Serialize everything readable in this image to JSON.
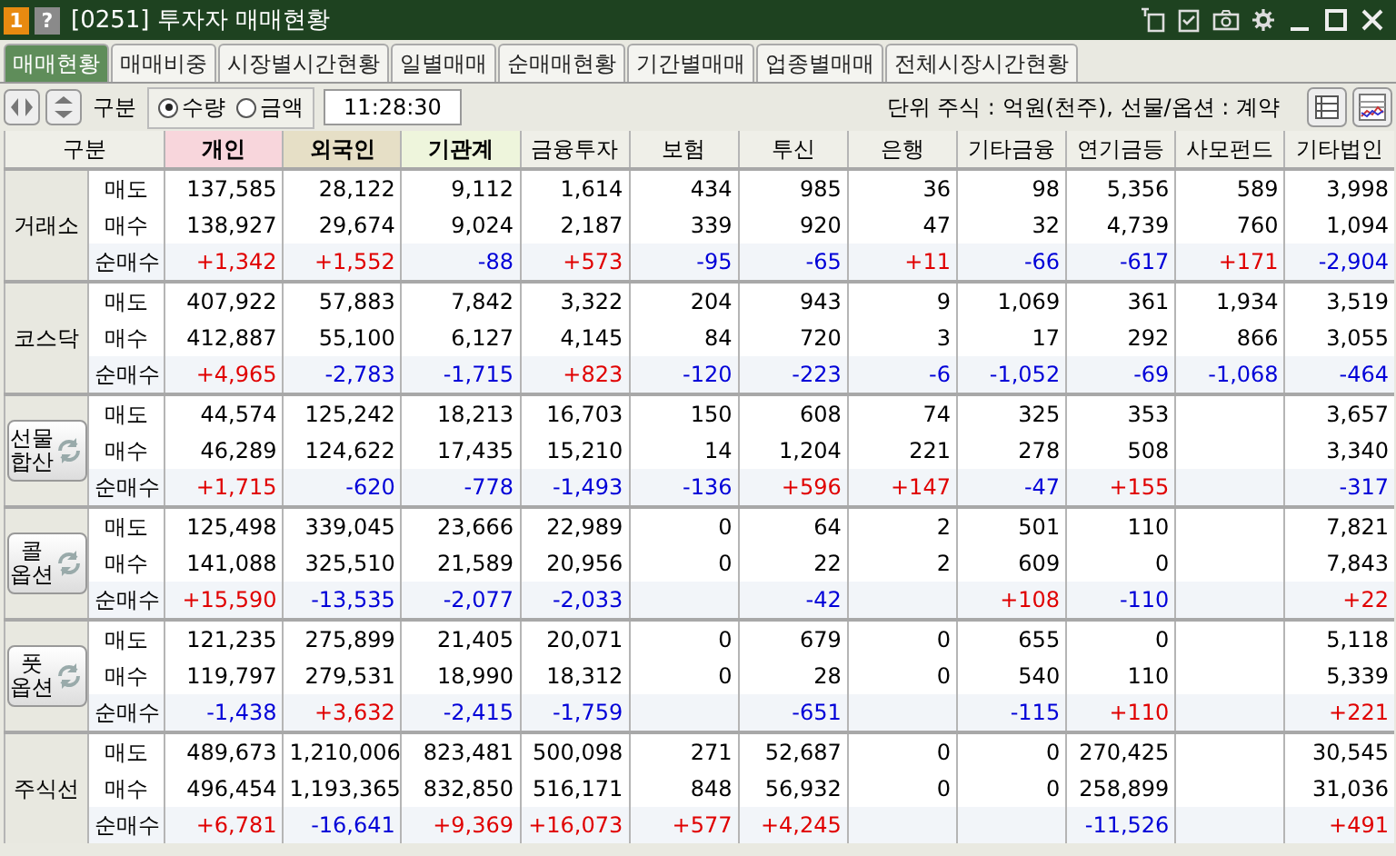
{
  "window": {
    "badge": "1",
    "help": "?",
    "title": "[0251] 투자자 매매현황"
  },
  "tabs": [
    {
      "label": "매매현황",
      "selected": true
    },
    {
      "label": "매매비중",
      "selected": false
    },
    {
      "label": "시장별시간현황",
      "selected": false
    },
    {
      "label": "일별매매",
      "selected": false
    },
    {
      "label": "순매매현황",
      "selected": false
    },
    {
      "label": "기간별매매",
      "selected": false
    },
    {
      "label": "업종별매매",
      "selected": false
    },
    {
      "label": "전체시장시간현황",
      "selected": false
    }
  ],
  "toolbar": {
    "label": "구분",
    "options": [
      {
        "label": "수량",
        "selected": true
      },
      {
        "label": "금액",
        "selected": false
      }
    ],
    "time": "11:28:30",
    "unit": "단위 주식 : 억원(천주), 선물/옵션 : 계약"
  },
  "table": {
    "header": "구분",
    "columns": [
      {
        "label": "개인",
        "color": "#f8d6dc"
      },
      {
        "label": "외국인",
        "color": "#e6dfc6"
      },
      {
        "label": "기관계",
        "color": "#eef5dc"
      },
      {
        "label": "금융투자"
      },
      {
        "label": "보험"
      },
      {
        "label": "투신"
      },
      {
        "label": "은행"
      },
      {
        "label": "기타금융"
      },
      {
        "label": "연기금등"
      },
      {
        "label": "사모펀드"
      },
      {
        "label": "기타법인"
      }
    ],
    "groups": [
      {
        "lines": [
          "거래소"
        ],
        "kind": "plain",
        "rows": [
          {
            "label": "매도",
            "kind": "sell",
            "cells": [
              "137,585",
              "28,122",
              "9,112",
              "1,614",
              "434",
              "985",
              "36",
              "98",
              "5,356",
              "589",
              "3,998"
            ]
          },
          {
            "label": "매수",
            "kind": "buy",
            "cells": [
              "138,927",
              "29,674",
              "9,024",
              "2,187",
              "339",
              "920",
              "47",
              "32",
              "4,739",
              "760",
              "1,094"
            ]
          },
          {
            "label": "순매수",
            "kind": "net",
            "cells": [
              {
                "value": "+1,342",
                "rise": true
              },
              {
                "value": "+1,552",
                "rise": true
              },
              {
                "value": "-88",
                "rise": false
              },
              {
                "value": "+573",
                "rise": true
              },
              {
                "value": "-95",
                "rise": false
              },
              {
                "value": "-65",
                "rise": false
              },
              {
                "value": "+11",
                "rise": true
              },
              {
                "value": "-66",
                "rise": false
              },
              {
                "value": "-617",
                "rise": false
              },
              {
                "value": "+171",
                "rise": true
              },
              {
                "value": "-2,904",
                "rise": false
              }
            ]
          }
        ]
      },
      {
        "lines": [
          "코스닥"
        ],
        "kind": "plain",
        "rows": [
          {
            "label": "매도",
            "kind": "sell",
            "cells": [
              "407,922",
              "57,883",
              "7,842",
              "3,322",
              "204",
              "943",
              "9",
              "1,069",
              "361",
              "1,934",
              "3,519"
            ]
          },
          {
            "label": "매수",
            "kind": "buy",
            "cells": [
              "412,887",
              "55,100",
              "6,127",
              "4,145",
              "84",
              "720",
              "3",
              "17",
              "292",
              "866",
              "3,055"
            ]
          },
          {
            "label": "순매수",
            "kind": "net",
            "cells": [
              {
                "value": "+4,965",
                "rise": true
              },
              {
                "value": "-2,783",
                "rise": false
              },
              {
                "value": "-1,715",
                "rise": false
              },
              {
                "value": "+823",
                "rise": true
              },
              {
                "value": "-120",
                "rise": false
              },
              {
                "value": "-223",
                "rise": false
              },
              {
                "value": "-6",
                "rise": false
              },
              {
                "value": "-1,052",
                "rise": false
              },
              {
                "value": "-69",
                "rise": false
              },
              {
                "value": "-1,068",
                "rise": false
              },
              {
                "value": "-464",
                "rise": false
              }
            ]
          }
        ]
      },
      {
        "lines": [
          "선물",
          "합산"
        ],
        "kind": "button",
        "rows": [
          {
            "label": "매도",
            "kind": "sell",
            "cells": [
              "44,574",
              "125,242",
              "18,213",
              "16,703",
              "150",
              "608",
              "74",
              "325",
              "353",
              null,
              "3,657"
            ]
          },
          {
            "label": "매수",
            "kind": "buy",
            "cells": [
              "46,289",
              "124,622",
              "17,435",
              "15,210",
              "14",
              "1,204",
              "221",
              "278",
              "508",
              null,
              "3,340"
            ]
          },
          {
            "label": "순매수",
            "kind": "net",
            "cells": [
              {
                "value": "+1,715",
                "rise": true
              },
              {
                "value": "-620",
                "rise": false
              },
              {
                "value": "-778",
                "rise": false
              },
              {
                "value": "-1,493",
                "rise": false
              },
              {
                "value": "-136",
                "rise": false
              },
              {
                "value": "+596",
                "rise": true
              },
              {
                "value": "+147",
                "rise": true
              },
              {
                "value": "-47",
                "rise": false
              },
              {
                "value": "+155",
                "rise": true
              },
              null,
              {
                "value": "-317",
                "rise": false
              }
            ]
          }
        ]
      },
      {
        "lines": [
          "콜",
          "옵션"
        ],
        "kind": "button",
        "rows": [
          {
            "label": "매도",
            "kind": "sell",
            "cells": [
              "125,498",
              "339,045",
              "23,666",
              "22,989",
              "0",
              "64",
              "2",
              "501",
              "110",
              null,
              "7,821"
            ]
          },
          {
            "label": "매수",
            "kind": "buy",
            "cells": [
              "141,088",
              "325,510",
              "21,589",
              "20,956",
              "0",
              "22",
              "2",
              "609",
              "0",
              null,
              "7,843"
            ]
          },
          {
            "label": "순매수",
            "kind": "net",
            "cells": [
              {
                "value": "+15,590",
                "rise": true
              },
              {
                "value": "-13,535",
                "rise": false
              },
              {
                "value": "-2,077",
                "rise": false
              },
              {
                "value": "-2,033",
                "rise": false
              },
              null,
              {
                "value": "-42",
                "rise": false
              },
              null,
              {
                "value": "+108",
                "rise": true
              },
              {
                "value": "-110",
                "rise": false
              },
              null,
              {
                "value": "+22",
                "rise": true
              }
            ]
          }
        ]
      },
      {
        "lines": [
          "풋",
          "옵션"
        ],
        "kind": "button",
        "rows": [
          {
            "label": "매도",
            "kind": "sell",
            "cells": [
              "121,235",
              "275,899",
              "21,405",
              "20,071",
              "0",
              "679",
              "0",
              "655",
              "0",
              null,
              "5,118"
            ]
          },
          {
            "label": "매수",
            "kind": "buy",
            "cells": [
              "119,797",
              "279,531",
              "18,990",
              "18,312",
              "0",
              "28",
              "0",
              "540",
              "110",
              null,
              "5,339"
            ]
          },
          {
            "label": "순매수",
            "kind": "net",
            "cells": [
              {
                "value": "-1,438",
                "rise": false
              },
              {
                "value": "+3,632",
                "rise": true
              },
              {
                "value": "-2,415",
                "rise": false
              },
              {
                "value": "-1,759",
                "rise": false
              },
              null,
              {
                "value": "-651",
                "rise": false
              },
              null,
              {
                "value": "-115",
                "rise": false
              },
              {
                "value": "+110",
                "rise": true
              },
              null,
              {
                "value": "+221",
                "rise": true
              }
            ]
          }
        ]
      },
      {
        "lines": [
          "주식선"
        ],
        "kind": "plain",
        "rows": [
          {
            "label": "매도",
            "kind": "sell",
            "cells": [
              "489,673",
              "1,210,006",
              "823,481",
              "500,098",
              "271",
              "52,687",
              "0",
              "0",
              "270,425",
              null,
              "30,545"
            ]
          },
          {
            "label": "매수",
            "kind": "buy",
            "cells": [
              "496,454",
              "1,193,365",
              "832,850",
              "516,171",
              "848",
              "56,932",
              "0",
              "0",
              "258,899",
              null,
              "31,036"
            ]
          },
          {
            "label": "순매수",
            "kind": "net",
            "cells": [
              {
                "value": "+6,781",
                "rise": true
              },
              {
                "value": "-16,641",
                "rise": false
              },
              {
                "value": "+9,369",
                "rise": true
              },
              {
                "value": "+16,073",
                "rise": true
              },
              {
                "value": "+577",
                "rise": true
              },
              {
                "value": "+4,245",
                "rise": true
              },
              null,
              null,
              {
                "value": "-11,526",
                "rise": false
              },
              null,
              {
                "value": "+491",
                "rise": true
              }
            ]
          }
        ]
      }
    ]
  }
}
